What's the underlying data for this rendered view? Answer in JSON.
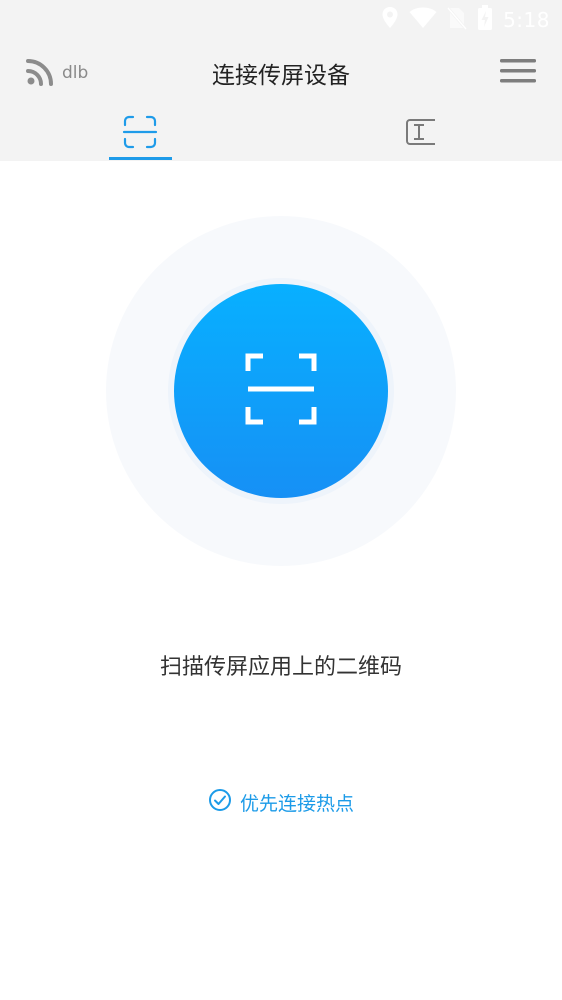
{
  "status_bar": {
    "time": "5:18",
    "icons": [
      "location-icon",
      "wifi-icon",
      "no-sim-icon",
      "battery-charging-icon"
    ]
  },
  "app_bar": {
    "device_name": "dlb",
    "title": "连接传屏设备",
    "left_icon": "cast-icon",
    "right_icon": "menu-icon"
  },
  "tabs": [
    {
      "icon": "scan-qr-icon",
      "selected": true
    },
    {
      "icon": "input-code-icon",
      "selected": false
    }
  ],
  "scan": {
    "button_icon": "scan-icon",
    "hint": "扫描传屏应用上的二维码"
  },
  "hotspot": {
    "label": "优先连接热点",
    "checked": true,
    "icon": "check-circle-icon"
  },
  "colors": {
    "accent": "#1c9be8",
    "button_top": "#08b0ff",
    "button_bottom": "#1690f5",
    "bar_bg": "#f3f3f3"
  }
}
